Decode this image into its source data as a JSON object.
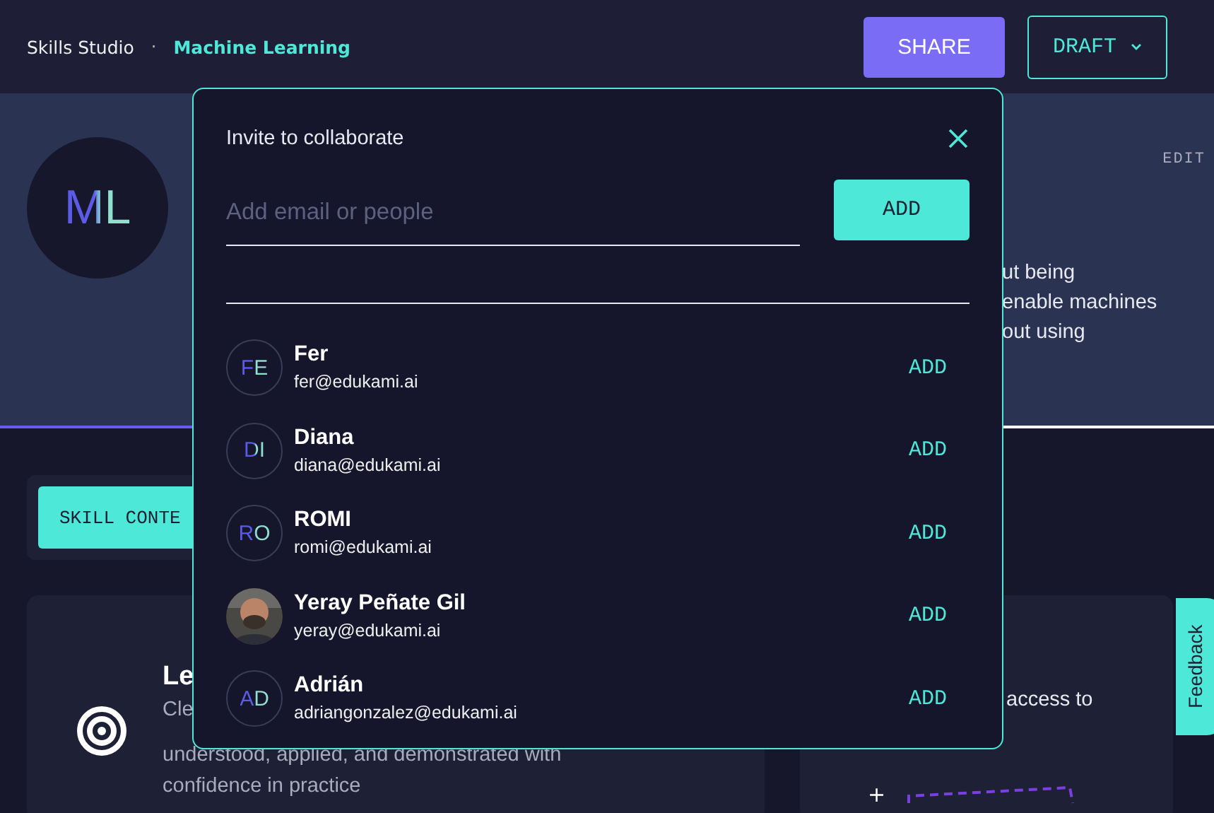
{
  "header": {
    "app": "Skills Studio",
    "separator": "·",
    "skill": "Machine Learning",
    "share": "SHARE",
    "draft": "DRAFT"
  },
  "hero": {
    "initials": "ML",
    "edit": "EDIT",
    "description_lines": [
      "ut being",
      "enable machines",
      "out using"
    ]
  },
  "tab": {
    "label": "SKILL CONTE"
  },
  "card_left": {
    "heading": "Le",
    "lines": [
      "Cle",
      "understood, applied, and demonstrated with",
      "confidence in practice"
    ]
  },
  "card_right": {
    "text": "access to",
    "plus": "+"
  },
  "feedback": "Feedback",
  "modal": {
    "title": "Invite to collaborate",
    "placeholder": "Add email or people",
    "add": "ADD",
    "people": [
      {
        "kind": "initials",
        "initials": "FE",
        "name": "Fer",
        "email": "fer@edukami.ai",
        "action": "ADD"
      },
      {
        "kind": "initials",
        "initials": "DI",
        "name": "Diana",
        "email": "diana@edukami.ai",
        "action": "ADD"
      },
      {
        "kind": "initials",
        "initials": "RO",
        "name": "ROMI",
        "email": "romi@edukami.ai",
        "action": "ADD"
      },
      {
        "kind": "picture",
        "name": "Yeray Peñate Gil",
        "email": "yeray@edukami.ai",
        "action": "ADD"
      },
      {
        "kind": "initials",
        "initials": "AD",
        "name": "Adrián",
        "email": "adriangonzalez@edukami.ai",
        "action": "ADD"
      }
    ]
  }
}
